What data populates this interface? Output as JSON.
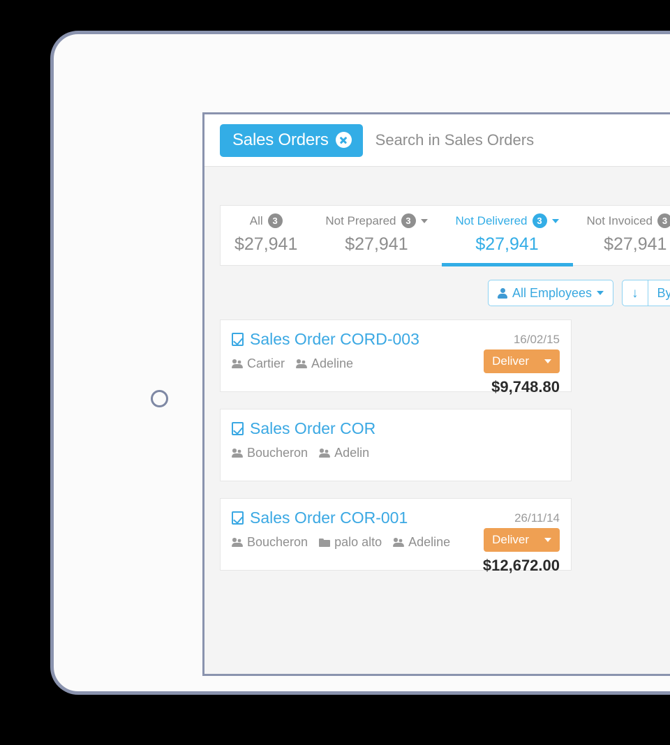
{
  "device": {
    "home_button": "home-button"
  },
  "header": {
    "facet_label": "Sales Orders",
    "facet_close_icon": "close-circle-icon",
    "search_placeholder": "Search in Sales Orders",
    "search_value": ""
  },
  "colors": {
    "accent_blue": "#33ade6",
    "link_blue": "#3aa8e3",
    "deliver_orange": "#efa053",
    "muted_gray": "#8f8f8f",
    "frame_gray": "#8a93ae"
  },
  "filter_tabs": [
    {
      "label": "All",
      "count": "3",
      "amount": "$27,941",
      "active": false,
      "has_caret": false
    },
    {
      "label": "Not Prepared",
      "count": "3",
      "amount": "$27,941",
      "active": false,
      "has_caret": true
    },
    {
      "label": "Not Delivered",
      "count": "3",
      "amount": "$27,941",
      "active": true,
      "has_caret": true
    },
    {
      "label": "Not Invoiced",
      "count": "3",
      "amount": "$27,941",
      "active": false,
      "has_caret": true
    }
  ],
  "toolbar": {
    "employees_label": "All Employees",
    "employees_icon": "person-icon",
    "sort_icon": "arrow-down-icon",
    "sort_label": "By Sales Ord"
  },
  "orders": [
    {
      "title": "Sales Order CORD-003",
      "date": "16/02/15",
      "tags": [
        {
          "icon": "users-icon",
          "label": "Cartier"
        },
        {
          "icon": "users-icon",
          "label": "Adeline"
        }
      ],
      "action_label": "Deliver",
      "amount": "$9,748.80"
    },
    {
      "title": "Sales Order COR",
      "date": "",
      "tags": [
        {
          "icon": "users-icon",
          "label": "Boucheron"
        },
        {
          "icon": "users-icon",
          "label": "Adelin"
        }
      ],
      "action_label": "",
      "amount": ""
    },
    {
      "title": "Sales Order COR-001",
      "date": "26/11/14",
      "tags": [
        {
          "icon": "users-icon",
          "label": "Boucheron"
        },
        {
          "icon": "folder-icon",
          "label": "palo alto"
        },
        {
          "icon": "users-icon",
          "label": "Adeline"
        }
      ],
      "action_label": "Deliver",
      "amount": "$12,672.00"
    }
  ]
}
